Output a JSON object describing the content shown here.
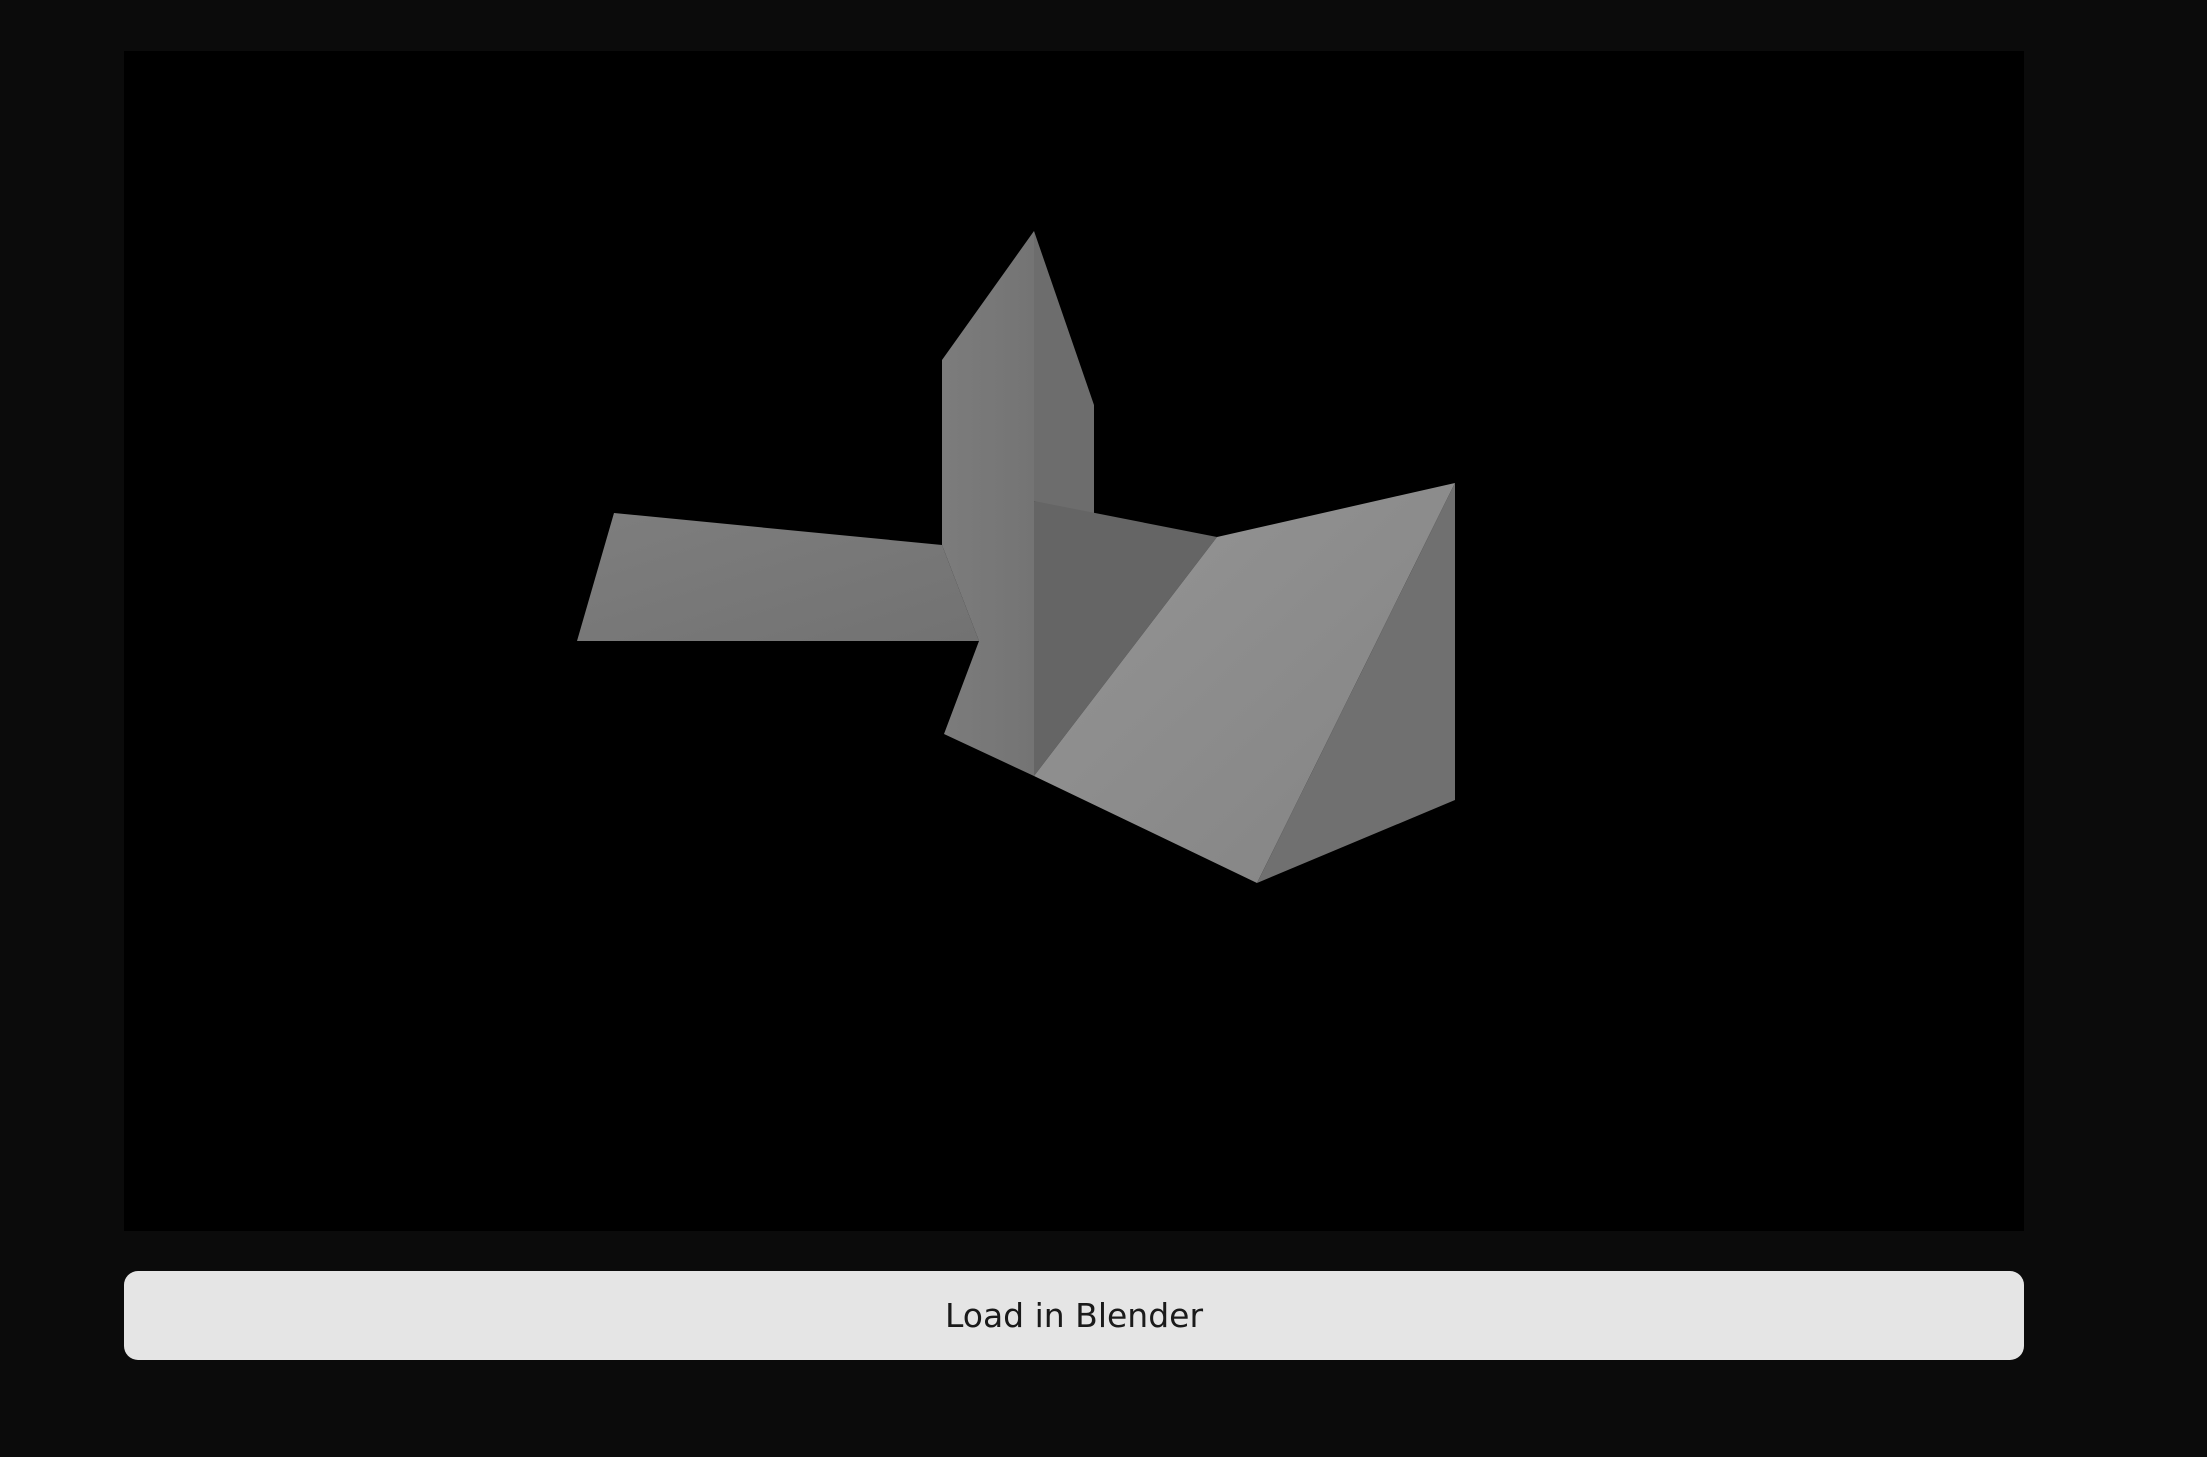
{
  "viewport": {
    "background": "#000000",
    "model_color": "#7a7a7a"
  },
  "actions": {
    "load_label": "Load in Blender"
  },
  "colors": {
    "page_background": "#0b0b0b",
    "button_background": "#e5e5e5",
    "button_text": "#1a1a1a"
  }
}
